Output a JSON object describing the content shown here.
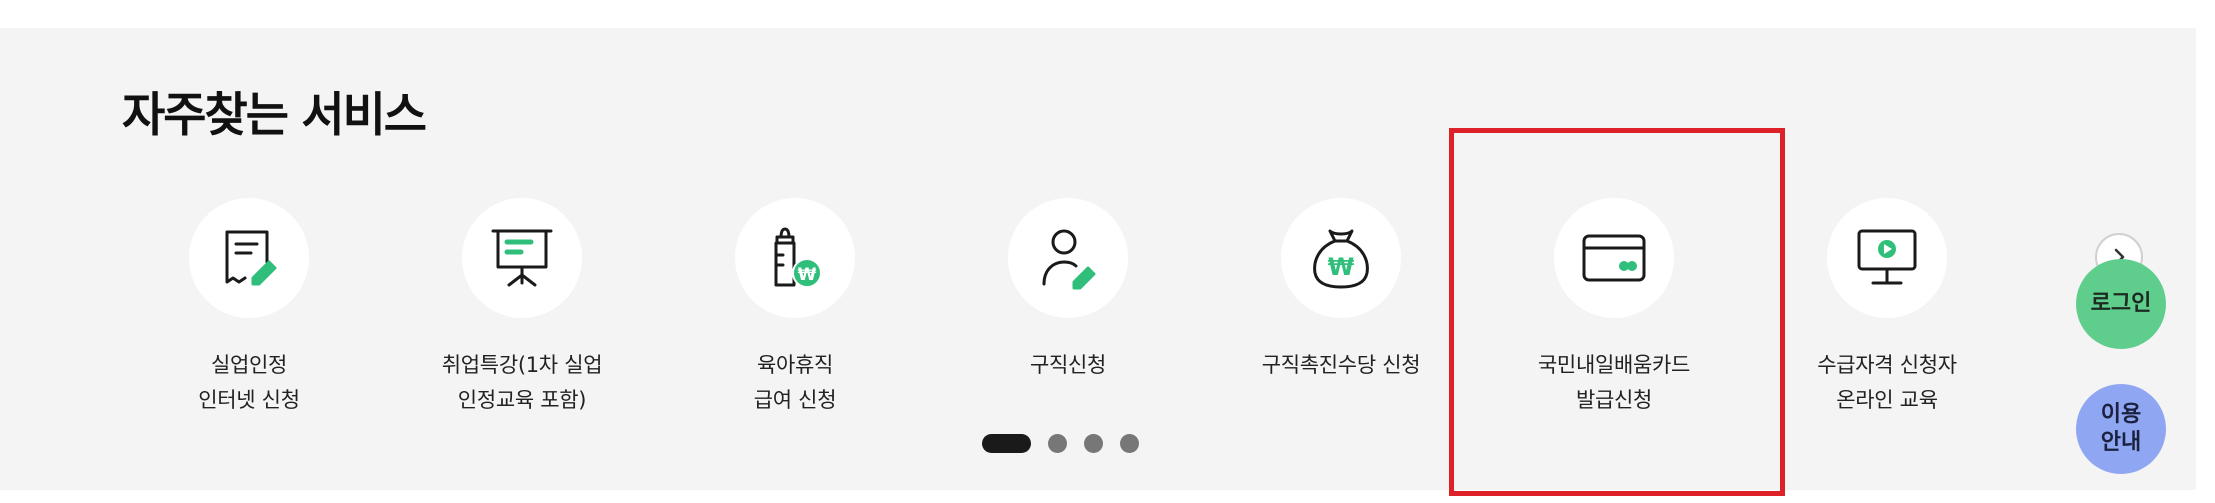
{
  "section": {
    "title": "자주찾는 서비스"
  },
  "services": [
    {
      "label": "실업인정\n인터넷 신청",
      "icon": "document-edit-icon"
    },
    {
      "label": "취업특강(1차 실업\n인정교육 포함)",
      "icon": "presentation-board-icon"
    },
    {
      "label": "육아휴직\n급여 신청",
      "icon": "baby-bottle-won-icon"
    },
    {
      "label": "구직신청",
      "icon": "person-edit-icon"
    },
    {
      "label": "구직촉진수당 신청",
      "icon": "money-bag-won-icon"
    },
    {
      "label": "국민내일배움카드\n발급신청",
      "icon": "card-icon"
    },
    {
      "label": "수급자격 신청자\n온라인 교육",
      "icon": "monitor-play-icon"
    }
  ],
  "pagination": {
    "total": 4,
    "active": 1
  },
  "next_button": {
    "icon": "chevron-right-icon"
  },
  "floating": {
    "login_label": "로그인",
    "guide_label": "이용\n안내"
  },
  "colors": {
    "accent_green": "#2fbf7a",
    "highlight_red": "#dc2228",
    "login_bg": "#5fce8d",
    "guide_bg": "#8fa6f2"
  }
}
